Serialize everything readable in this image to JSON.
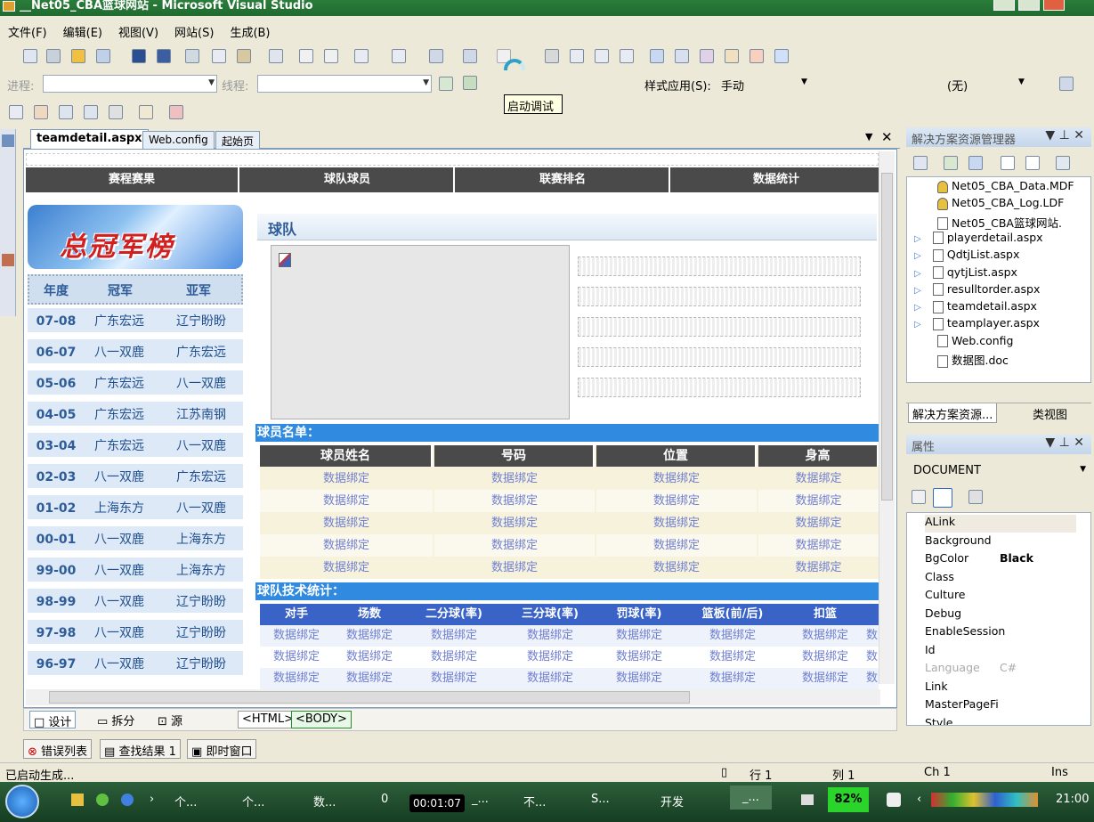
{
  "window": {
    "title": "__Net05_CBA篮球网站 - Microsoft Visual Studio"
  },
  "menu": [
    "文件(F)",
    "编辑(E)",
    "视图(V)",
    "网站(S)",
    "生成(B)"
  ],
  "toolbar": {
    "progress_label": "进程:",
    "thread_label": "线程:",
    "style_apply_label": "样式应用(S):",
    "style_apply_value": "手动",
    "target_value": "(无)",
    "tooltip": "启动调试"
  },
  "doc_tabs": [
    "teamdetail.aspx",
    "Web.config",
    "起始页"
  ],
  "site": {
    "nav": [
      "赛程赛果",
      "球队球员",
      "联赛排名",
      "数据统计"
    ],
    "banner_text": "总冠军榜",
    "champ_headers": [
      "年度",
      "冠军",
      "亚军"
    ],
    "champions": [
      {
        "year": "07-08",
        "champ": "广东宏远",
        "runner": "辽宁盼盼"
      },
      {
        "year": "06-07",
        "champ": "八一双鹿",
        "runner": "广东宏远"
      },
      {
        "year": "05-06",
        "champ": "广东宏远",
        "runner": "八一双鹿"
      },
      {
        "year": "04-05",
        "champ": "广东宏远",
        "runner": "江苏南钢"
      },
      {
        "year": "03-04",
        "champ": "广东宏远",
        "runner": "八一双鹿"
      },
      {
        "year": "02-03",
        "champ": "八一双鹿",
        "runner": "广东宏远"
      },
      {
        "year": "01-02",
        "champ": "上海东方",
        "runner": "八一双鹿"
      },
      {
        "year": "00-01",
        "champ": "八一双鹿",
        "runner": "上海东方"
      },
      {
        "year": "99-00",
        "champ": "八一双鹿",
        "runner": "上海东方"
      },
      {
        "year": "98-99",
        "champ": "八一双鹿",
        "runner": "辽宁盼盼"
      },
      {
        "year": "97-98",
        "champ": "八一双鹿",
        "runner": "辽宁盼盼"
      },
      {
        "year": "96-97",
        "champ": "八一双鹿",
        "runner": "辽宁盼盼"
      }
    ],
    "team_title": "球队",
    "roster_title": "球员名单：",
    "roster_headers": [
      "球员姓名",
      "号码",
      "位置",
      "身高"
    ],
    "bind_text": "数据绑定",
    "stats_title": "球队技术统计：",
    "stats_headers": [
      "对手",
      "场数",
      "二分球(率)",
      "三分球(率)",
      "罚球(率)",
      "篮板(前/后)",
      "扣篮"
    ],
    "stats_overflow": "数"
  },
  "view_bar": {
    "design": "设计",
    "split": "拆分",
    "source": "源",
    "tag_html": "<HTML>",
    "tag_body": "<BODY>"
  },
  "solution_explorer": {
    "title": "解决方案资源管理器",
    "files": [
      "Net05_CBA_Data.MDF",
      "Net05_CBA_Log.LDF",
      "Net05_CBA篮球网站.",
      "playerdetail.aspx",
      "QdtjList.aspx",
      "qytjList.aspx",
      "resulltorder.aspx",
      "teamdetail.aspx",
      "teamplayer.aspx",
      "Web.config",
      "数据图.doc"
    ],
    "tab_solution": "解决方案资源...",
    "tab_class": "类视图"
  },
  "properties": {
    "title": "属性",
    "object": "DOCUMENT",
    "rows": [
      {
        "name": "ALink",
        "value": ""
      },
      {
        "name": "Background",
        "value": ""
      },
      {
        "name": "BgColor",
        "value": "Black"
      },
      {
        "name": "Class",
        "value": ""
      },
      {
        "name": "Culture",
        "value": ""
      },
      {
        "name": "Debug",
        "value": ""
      },
      {
        "name": "EnableSession",
        "value": ""
      },
      {
        "name": "Id",
        "value": ""
      },
      {
        "name": "Language",
        "value": "C#"
      },
      {
        "name": "Link",
        "value": ""
      },
      {
        "name": "MasterPageFi",
        "value": ""
      },
      {
        "name": "Style",
        "value": ""
      }
    ]
  },
  "bottom_tabs": [
    "错误列表",
    "查找结果 1",
    "即时窗口"
  ],
  "status": {
    "message": "已启动生成...",
    "line": "行 1",
    "col": "列 1",
    "ch": "Ch 1",
    "mode": "Ins"
  },
  "taskbar": {
    "items": [
      "个...",
      "个...",
      "数...",
      "0",
      "_...",
      "不...",
      "S...",
      "开发",
      "_..."
    ],
    "timer": "00:01:07",
    "battery": "82%",
    "clock": "21:00"
  }
}
